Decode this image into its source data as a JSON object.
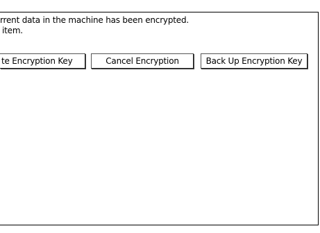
{
  "message": {
    "line1": "rrent data in the machine has been encrypted.",
    "line2": "item."
  },
  "buttons": {
    "update_encryption_key": "te Encryption Key",
    "cancel_encryption": "Cancel Encryption",
    "back_up_encryption_key": "Back Up Encryption Key"
  }
}
